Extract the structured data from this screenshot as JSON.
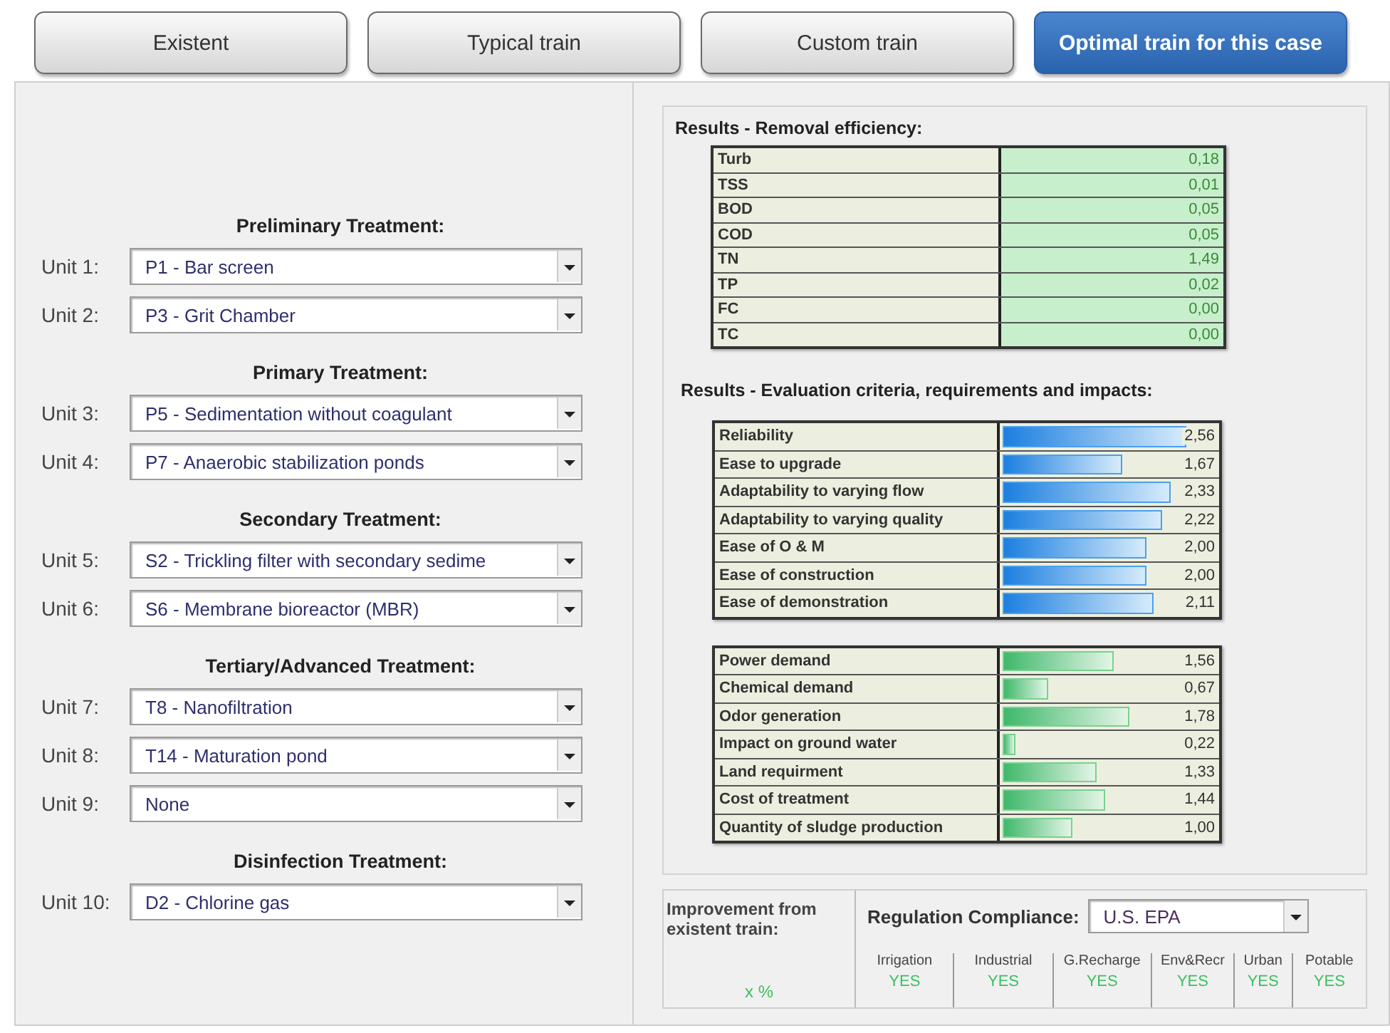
{
  "tabs": [
    {
      "label": "Existent",
      "selected": false
    },
    {
      "label": "Typical train",
      "selected": false
    },
    {
      "label": "Custom train",
      "selected": false
    },
    {
      "label": "Optimal train for this case",
      "selected": true
    }
  ],
  "treatment_sections": [
    {
      "heading": "Preliminary Treatment:",
      "units": [
        {
          "label": "Unit 1:",
          "value": "P1 - Bar screen"
        },
        {
          "label": "Unit 2:",
          "value": "P3 - Grit Chamber"
        }
      ]
    },
    {
      "heading": "Primary Treatment:",
      "units": [
        {
          "label": "Unit 3:",
          "value": "P5 - Sedimentation without coagulant"
        },
        {
          "label": "Unit 4:",
          "value": "P7 - Anaerobic stabilization ponds"
        }
      ]
    },
    {
      "heading": "Secondary Treatment:",
      "units": [
        {
          "label": "Unit 5:",
          "value": "S2 - Trickling filter with secondary sedime"
        },
        {
          "label": "Unit 6:",
          "value": "S6 - Membrane bioreactor (MBR)"
        }
      ]
    },
    {
      "heading": "Tertiary/Advanced Treatment:",
      "units": [
        {
          "label": "Unit 7:",
          "value": "T8 - Nanofiltration"
        },
        {
          "label": "Unit 8:",
          "value": "T14 - Maturation pond"
        },
        {
          "label": "Unit 9:",
          "value": "None"
        }
      ]
    },
    {
      "heading": "Disinfection Treatment:",
      "units": [
        {
          "label": "Unit 10:",
          "value": "D2 - Chlorine gas"
        }
      ]
    }
  ],
  "removal_efficiency": {
    "title": "Results - Removal efficiency:",
    "rows": [
      {
        "parameter": "Turb",
        "value": "0,18"
      },
      {
        "parameter": "TSS",
        "value": "0,01"
      },
      {
        "parameter": "BOD",
        "value": "0,05"
      },
      {
        "parameter": "COD",
        "value": "0,05"
      },
      {
        "parameter": "TN",
        "value": "1,49"
      },
      {
        "parameter": "TP",
        "value": "0,02"
      },
      {
        "parameter": "FC",
        "value": "0,00"
      },
      {
        "parameter": "TC",
        "value": "0,00"
      }
    ]
  },
  "evaluation": {
    "title": "Results - Evaluation criteria, requirements and impacts:",
    "groups": [
      {
        "kind": "criteria",
        "rows": [
          {
            "name": "Reliability",
            "value": "2,56",
            "level": 0.85
          },
          {
            "name": "Ease to upgrade",
            "value": "1,67",
            "level": 0.56
          },
          {
            "name": "Adaptability to varying flow",
            "value": "2,33",
            "level": 0.78
          },
          {
            "name": "Adaptability to varying quality",
            "value": "2,22",
            "level": 0.74
          },
          {
            "name": "Ease of O & M",
            "value": "2,00",
            "level": 0.67
          },
          {
            "name": "Ease of construction",
            "value": "2,00",
            "level": 0.67
          },
          {
            "name": "Ease of demonstration",
            "value": "2,11",
            "level": 0.7
          }
        ]
      },
      {
        "kind": "impacts",
        "rows": [
          {
            "name": "Power demand",
            "value": "1,56",
            "level": 0.52
          },
          {
            "name": "Chemical demand",
            "value": "0,67",
            "level": 0.22
          },
          {
            "name": "Odor generation",
            "value": "1,78",
            "level": 0.59
          },
          {
            "name": "Impact on ground water",
            "value": "0,22",
            "level": 0.07
          },
          {
            "name": "Land requirment",
            "value": "1,33",
            "level": 0.44
          },
          {
            "name": "Cost of treatment",
            "value": "1,44",
            "level": 0.48
          },
          {
            "name": "Quantity of sludge production",
            "value": "1,00",
            "level": 0.33
          }
        ]
      }
    ]
  },
  "improvement": {
    "label": "Improvement from existent train:",
    "value": "x %"
  },
  "compliance": {
    "label": "Regulation Compliance:",
    "standard": "U.S. EPA",
    "uses": [
      {
        "name": "Irrigation",
        "status": "YES"
      },
      {
        "name": "Industrial",
        "status": "YES"
      },
      {
        "name": "G.Recharge",
        "status": "YES"
      },
      {
        "name": "Env&Recr",
        "status": "YES"
      },
      {
        "name": "Urban",
        "status": "YES"
      },
      {
        "name": "Potable",
        "status": "YES"
      }
    ]
  }
}
